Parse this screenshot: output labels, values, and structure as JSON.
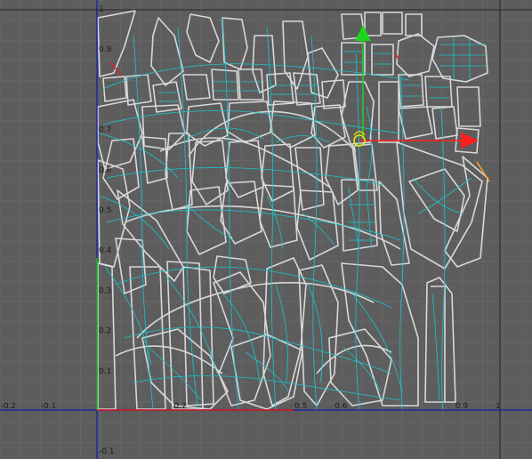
{
  "colors": {
    "background": "#5d5d5d",
    "grid_minor": "#666666",
    "grid_major": "#2b2b2b",
    "axis_line": "#1f2a9c",
    "uv_shell": "#d8d8d8",
    "uv_wire": "#18c6cf",
    "gizmo_u": "#ff1e1e",
    "gizmo_v": "#1ed41e",
    "handle_yellow": "#e8e800",
    "handle_orange": "#ff9a2a"
  },
  "axes": {
    "x_ticks": [
      {
        "v": -0.2,
        "label": "-0.2"
      },
      {
        "v": -0.1,
        "label": "-0.1"
      },
      {
        "v": 0.2,
        "label": "0.2"
      },
      {
        "v": 0.5,
        "label": "0.5"
      },
      {
        "v": 0.6,
        "label": "0.6"
      },
      {
        "v": 0.9,
        "label": "0.9"
      },
      {
        "v": 1.0,
        "label": "1"
      }
    ],
    "y_ticks": [
      {
        "v": 1.0,
        "label": "1"
      },
      {
        "v": 0.9,
        "label": "0.9"
      },
      {
        "v": 0.7,
        "label": "0.7"
      },
      {
        "v": 0.6,
        "label": "0.6"
      },
      {
        "v": 0.5,
        "label": "0.5"
      },
      {
        "v": 0.4,
        "label": "0.4"
      },
      {
        "v": 0.3,
        "label": "0.3"
      },
      {
        "v": 0.2,
        "label": "0.2"
      },
      {
        "v": 0.1,
        "label": "0.1"
      },
      {
        "v": -0.1,
        "label": "-0.1"
      }
    ]
  },
  "gizmo": {
    "u_arrow_icon": "arrow-right-icon",
    "v_arrow_icon": "arrow-up-icon",
    "pivot_icon": "pivot-handle-icon"
  }
}
